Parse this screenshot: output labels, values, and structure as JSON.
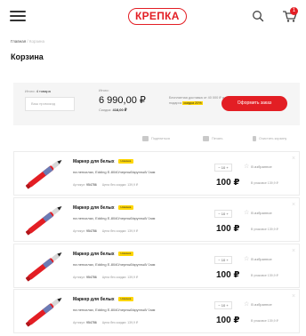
{
  "header": {
    "logo_text": "КРЕПКА",
    "cart_count": "1"
  },
  "breadcrumb": {
    "home": "Главная",
    "separator": " / ",
    "current": "Корзина"
  },
  "page_title": "Корзина",
  "summary": {
    "items_label": "Итого:",
    "items_count": "4 товара",
    "promo_placeholder": "Ваш промокод",
    "total_label": "Итого:",
    "total": "6 990,00 ₽",
    "discount_label": "Скидка:",
    "discount_value": "418,00 ₽",
    "note_text": "Бесплатная доставка от 40 000 ₽ и подарок",
    "note_highlight": "скидка 20%",
    "order_button": "Оформить заказ"
  },
  "toolbar": {
    "share": "Поделиться",
    "print": "Печать",
    "clear": "Очистить корзину"
  },
  "items": [
    {
      "name": "Маркер для белых",
      "badge": "Новинка",
      "desc": "на пенсилах, Edding E-8040/черный/круглый/ 1мм",
      "article_label": "Артикул:",
      "article": "954786",
      "price_note": "Цена без скидки: 139,9 ₽",
      "qty": "10",
      "fav": "В избранное",
      "price": "100 ₽",
      "pack": "В упаковке 139,9 ₽"
    },
    {
      "name": "Маркер для белых",
      "badge": "Новинка",
      "desc": "на пенсилах, Edding E-8040/черный/круглый/ 1мм",
      "article_label": "Артикул:",
      "article": "954786",
      "price_note": "Цена без скидки: 139,9 ₽",
      "qty": "10",
      "fav": "В избранное",
      "price": "100 ₽",
      "pack": "В упаковке 139,9 ₽"
    },
    {
      "name": "Маркер для белых",
      "badge": "Новинка",
      "desc": "на пенсилах, Edding E-8040/черный/круглый/ 1мм",
      "article_label": "Артикул:",
      "article": "954786",
      "price_note": "Цена без скидки: 139,9 ₽",
      "qty": "10",
      "fav": "В избранное",
      "price": "100 ₽",
      "pack": "В упаковке 139,9 ₽"
    },
    {
      "name": "Маркер для белых",
      "badge": "Новинка",
      "desc": "на пенсилах, Edding E-8040/черный/круглый/ 1мм",
      "article_label": "Артикул:",
      "article": "954786",
      "price_note": "Цена без скидки: 139,9 ₽",
      "qty": "10",
      "fav": "В избранное",
      "price": "100 ₽",
      "pack": "В упаковке 139,9 ₽"
    }
  ],
  "colors": {
    "accent": "#e31e24",
    "highlight": "#ffd600"
  },
  "icons": {
    "menu": "burger-icon",
    "search": "search-icon",
    "cart": "cart-icon",
    "favorite": "star-icon",
    "delete": "close-icon"
  }
}
